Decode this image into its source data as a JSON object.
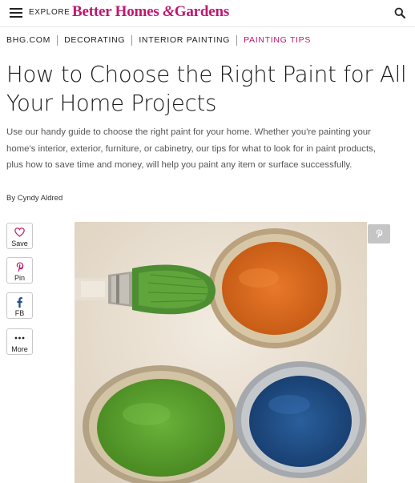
{
  "header": {
    "explore_label": "EXPLORE",
    "logo_text_1": "Better Homes",
    "logo_amp": "&",
    "logo_text_2": "Gardens",
    "icons": {
      "menu": "hamburger-menu-icon",
      "search": "search-icon"
    },
    "brand_color": "#c0166e"
  },
  "breadcrumb": {
    "items": [
      "BHG.COM",
      "DECORATING",
      "INTERIOR PAINTING",
      "PAINTING TIPS"
    ],
    "active_index": 3
  },
  "article": {
    "title": "How to Choose the Right Paint for All Your Home Projects",
    "description": "Use our handy guide to choose the right paint for your home. Whether you're painting your home's interior, exterior, furniture, or cabinetry, our tips for what to look for in paint products, plus how to save time and money, will help you paint any item or surface successfully.",
    "byline_prefix": "By",
    "author": "Cyndy Aldred"
  },
  "share": {
    "save": {
      "label": "Save",
      "icon": "heart-icon"
    },
    "pin": {
      "label": "Pin",
      "icon": "pinterest-icon"
    },
    "fb": {
      "label": "FB",
      "icon": "facebook-icon"
    },
    "more": {
      "label": "More",
      "icon": "more-dots-icon"
    }
  },
  "hero": {
    "alt_subject": "paint brush and open paint cans",
    "paint_colors": {
      "orange": "#e0691e",
      "green": "#5aa22d",
      "blue": "#1f4f8a",
      "brush_green": "#4e8e32"
    },
    "pin_icon": "pinterest-icon"
  }
}
